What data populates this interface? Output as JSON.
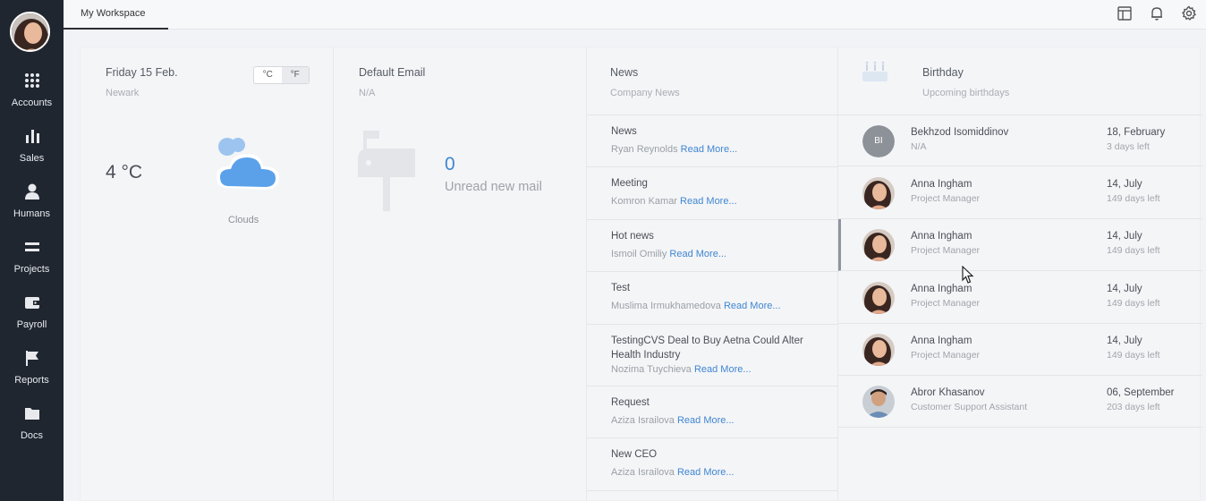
{
  "sidebar": {
    "items": [
      {
        "label": "Accounts",
        "icon": "grid-icon"
      },
      {
        "label": "Sales",
        "icon": "bar-chart-icon"
      },
      {
        "label": "Humans",
        "icon": "person-icon"
      },
      {
        "label": "Projects",
        "icon": "equals-icon"
      },
      {
        "label": "Payroll",
        "icon": "wallet-icon"
      },
      {
        "label": "Reports",
        "icon": "flag-icon"
      },
      {
        "label": "Docs",
        "icon": "folder-icon"
      }
    ]
  },
  "topbar": {
    "tab_label": "My Workspace",
    "icons": [
      "layout-icon",
      "bell-icon",
      "gear-icon"
    ]
  },
  "weather": {
    "date": "Friday 15 Feb.",
    "city": "Newark",
    "unit_c": "°C",
    "unit_f": "°F",
    "temperature": "4 °C",
    "condition": "Clouds"
  },
  "email": {
    "title": "Default Email",
    "subtitle": "N/A",
    "count": "0",
    "label": "Unread new mail"
  },
  "news": {
    "title": "News",
    "subtitle": "Company News",
    "read_more": "Read More...",
    "items": [
      {
        "title": "News",
        "author": "Ryan Reynolds"
      },
      {
        "title": "Meeting",
        "author": "Komron Kamar"
      },
      {
        "title": "Hot news",
        "author": "Ismoil Omiliy"
      },
      {
        "title": "Test",
        "author": "Muslima Irmukhamedova"
      },
      {
        "title": "TestingCVS Deal to Buy Aetna Could Alter Health Industry",
        "author": "Nozima Tuychieva"
      },
      {
        "title": "Request",
        "author": "Aziza Israilova"
      },
      {
        "title": "New CEO",
        "author": "Aziza Israilova"
      }
    ]
  },
  "birthday": {
    "title": "Birthday",
    "subtitle": "Upcoming birthdays",
    "people": [
      {
        "name": "Bekhzod Isomiddinov",
        "role": "N/A",
        "date": "18, February",
        "left": "3 days left",
        "initials": "BI"
      },
      {
        "name": "Anna Ingham",
        "role": "Project Manager",
        "date": "14, July",
        "left": "149 days left"
      },
      {
        "name": "Anna Ingham",
        "role": "Project Manager",
        "date": "14, July",
        "left": "149 days left"
      },
      {
        "name": "Anna Ingham",
        "role": "Project Manager",
        "date": "14, July",
        "left": "149 days left"
      },
      {
        "name": "Anna Ingham",
        "role": "Project Manager",
        "date": "14, July",
        "left": "149 days left"
      },
      {
        "name": "Abror Khasanov",
        "role": "Customer Support Assistant",
        "date": "06, September",
        "left": "203 days left"
      }
    ]
  },
  "colors": {
    "sidebar_bg": "#1f2630",
    "accent": "#3f86d2",
    "cloud": "#5aa1ea"
  }
}
